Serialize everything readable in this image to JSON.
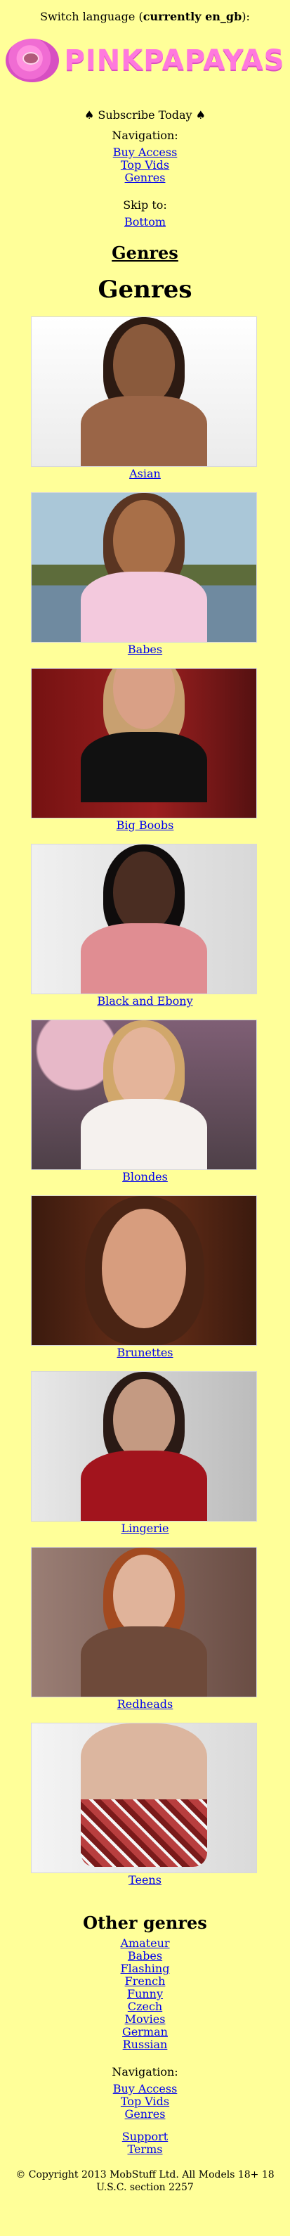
{
  "header": {
    "switch_language_prefix": "Switch language (",
    "switch_language_current": "currently en_gb",
    "switch_language_suffix": "):",
    "logo_text": "PINKPAPAYAS"
  },
  "subscribe": "♠ Subscribe Today ♠",
  "top_nav": {
    "label": "Navigation:",
    "items": [
      "Buy Access",
      "Top Vids",
      "Genres"
    ]
  },
  "skip": {
    "label": "Skip to:",
    "items": [
      "Bottom"
    ]
  },
  "headings": {
    "genres_link": "Genres",
    "genres_title": "Genres",
    "other_genres": "Other genres"
  },
  "genres": [
    {
      "label": "Asian",
      "colors": {
        "bg": "#f0f0f0",
        "skin": "#8a5a3c",
        "hair": "#2c1a12",
        "cloth": "#d49b7b"
      }
    },
    {
      "label": "Babes",
      "colors": {
        "bg": "#7fa5b5",
        "skin": "#a86f48",
        "hair": "#5a3522",
        "cloth": "#f3c9dd"
      }
    },
    {
      "label": "Big Boobs",
      "colors": {
        "bg": "#8a1a1a",
        "skin": "#d9a086",
        "hair": "#c8a070",
        "cloth": "#111111"
      }
    },
    {
      "label": "Black and Ebony",
      "colors": {
        "bg": "#dddddd",
        "skin": "#4a2d22",
        "hair": "#0f0c0c",
        "cloth": "#e08d92"
      }
    },
    {
      "label": "Blondes",
      "colors": {
        "bg": "#7b5f68",
        "skin": "#e4b49a",
        "hair": "#d1a76b",
        "cloth": "#f5f1ee"
      }
    },
    {
      "label": "Brunettes",
      "colors": {
        "bg": "#5a2a16",
        "skin": "#d79d7e",
        "hair": "#4a2414",
        "cloth": "#8a4a30"
      }
    },
    {
      "label": "Lingerie",
      "colors": {
        "bg": "#cfcfcf",
        "skin": "#c49a82",
        "hair": "#2a1a15",
        "cloth": "#a2141d"
      }
    },
    {
      "label": "Redheads",
      "colors": {
        "bg": "#8a6b62",
        "skin": "#e0b39a",
        "hair": "#a24a20",
        "cloth": "#6e4a3a"
      }
    },
    {
      "label": "Teens",
      "colors": {
        "bg": "#ececec",
        "skin": "#dcb69f",
        "hair": "#7a4b30",
        "cloth": "#b83e3e"
      }
    }
  ],
  "other_genres": [
    "Amateur",
    "Babes",
    "Flashing",
    "French",
    "Funny",
    "Czech",
    "Movies",
    "German",
    "Russian"
  ],
  "bottom_nav": {
    "label": "Navigation:",
    "items": [
      "Buy Access",
      "Top Vids",
      "Genres"
    ],
    "extra": [
      "Support",
      "Terms"
    ]
  },
  "copyright": "© Copyright 2013 MobStuff Ltd. All Models 18+ 18 U.S.C. section 2257"
}
